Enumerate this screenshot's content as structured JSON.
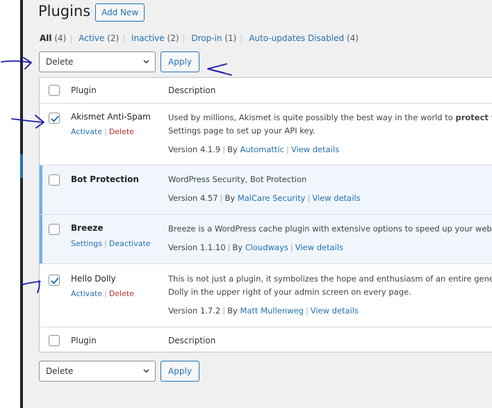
{
  "header": {
    "title": "Plugins",
    "add_new_label": "Add New"
  },
  "filters": [
    {
      "label": "All",
      "count": "(4)",
      "current": true
    },
    {
      "label": "Active",
      "count": "(2)",
      "current": false
    },
    {
      "label": "Inactive",
      "count": "(2)",
      "current": false
    },
    {
      "label": "Drop-in",
      "count": "(1)",
      "current": false
    },
    {
      "label": "Auto-updates Disabled",
      "count": "(4)",
      "current": false
    }
  ],
  "bulk_top": {
    "selected": "Delete",
    "apply_label": "Apply"
  },
  "bulk_bottom": {
    "selected": "Delete",
    "apply_label": "Apply"
  },
  "table": {
    "columns": {
      "plugin": "Plugin",
      "description": "Description"
    },
    "rows": [
      {
        "name": "Akismet Anti-Spam",
        "checked": true,
        "active": false,
        "actions": [
          "Activate",
          "Delete"
        ],
        "desc_line1_pre": "Used by millions, Akismet is quite possibly the best way in the world to ",
        "desc_line1_bold": "protect yo",
        "desc_line2": "Settings page to set up your API key.",
        "version": "Version 4.1.9",
        "by": "By",
        "author": "Automattic",
        "details": "View details"
      },
      {
        "name": "Bot Protection",
        "checked": false,
        "active": true,
        "actions": [],
        "desc_line1": "WordPress Security, Bot Protection",
        "version": "Version 4.57",
        "by": "By",
        "author": "MalCare Security",
        "details": "View details"
      },
      {
        "name": "Breeze",
        "checked": false,
        "active": true,
        "actions": [
          "Settings",
          "Deactivate"
        ],
        "desc_line1": "Breeze is a WordPress cache plugin with extensive options to speed up your webs",
        "version": "Version 1.1.10",
        "by": "By",
        "author": "Cloudways",
        "details": "View details"
      },
      {
        "name": "Hello Dolly",
        "checked": true,
        "active": false,
        "actions": [
          "Activate",
          "Delete"
        ],
        "desc_line1": "This is not just a plugin, it symbolizes the hope and enthusiasm of an entire gener",
        "desc_line2": "Dolly in the upper right of your admin screen on every page.",
        "version": "Version 1.7.2",
        "by": "By",
        "author": "Matt Mullenweg",
        "details": "View details"
      }
    ]
  },
  "colors": {
    "link": "#2271b1",
    "delete": "#b32d2e",
    "active_row": "#f0f6fc",
    "active_bar": "#72aee6",
    "annotation": "#1a1aa6"
  }
}
